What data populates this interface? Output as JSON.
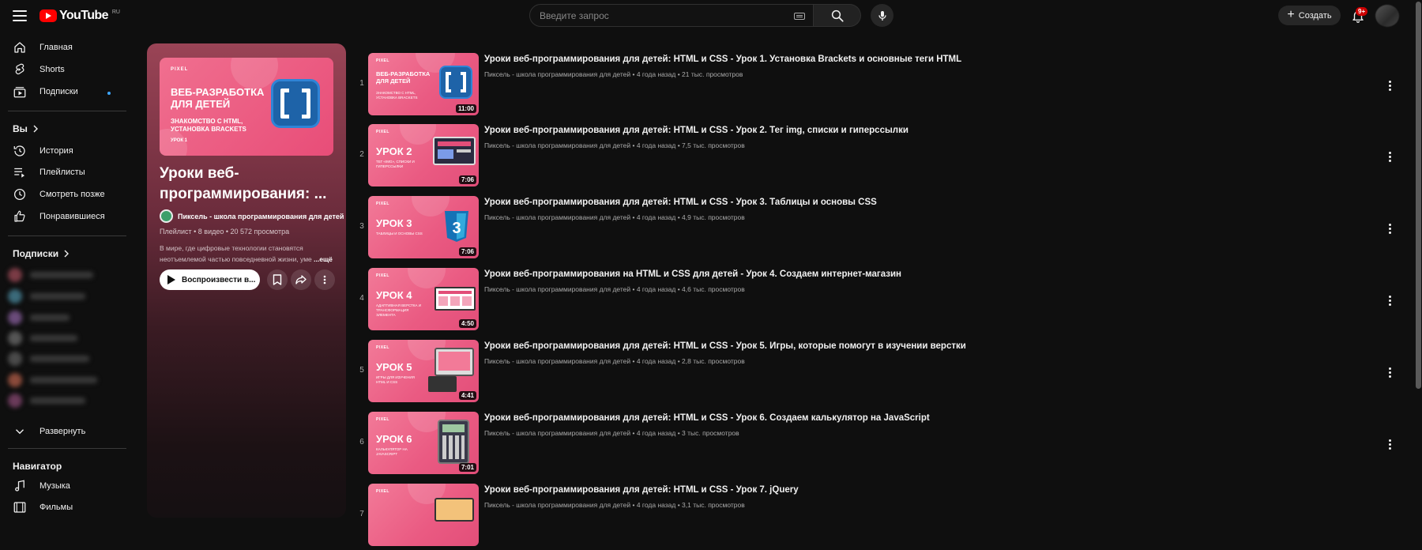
{
  "header": {
    "logo_text": "YouTube",
    "region": "RU",
    "search_placeholder": "Введите запрос",
    "create_label": "Создать",
    "notifications_badge": "9+"
  },
  "sidebar": {
    "main": [
      {
        "label": "Главная",
        "icon": "home-icon"
      },
      {
        "label": "Shorts",
        "icon": "shorts-icon"
      },
      {
        "label": "Подписки",
        "icon": "subscriptions-icon"
      }
    ],
    "you_label": "Вы",
    "you_items": [
      {
        "label": "История",
        "icon": "history-icon"
      },
      {
        "label": "Плейлисты",
        "icon": "playlists-icon"
      },
      {
        "label": "Смотреть позже",
        "icon": "watch-later-icon"
      },
      {
        "label": "Понравившиеся",
        "icon": "like-icon"
      }
    ],
    "subscriptions_label": "Подписки",
    "expand_label": "Развернуть",
    "navigator_label": "Навигатор",
    "navigator_items": [
      {
        "label": "Музыка",
        "icon": "music-icon"
      },
      {
        "label": "Фильмы",
        "icon": "movies-icon"
      }
    ]
  },
  "playlist": {
    "thumb_brand": "PIXEL",
    "thumb_title": "ВЕБ-РАЗРАБОТКА ДЛЯ ДЕТЕЙ",
    "thumb_subtitle": "ЗНАКОМСТВО С HTML, УСТАНОВКА BRACKETS",
    "thumb_lesson": "УРОК 1",
    "title": "Уроки веб-программирования: ...",
    "channel": "Пиксель - школа программирования для детей",
    "meta": "Плейлист • 8 видео • 20 572 просмотра",
    "description": "В мире, где цифровые технологии становятся неотъемлемой частью повседневной жизни, уме",
    "more_label": "...ещё",
    "play_label": "Воспроизвести в..."
  },
  "videos": [
    {
      "index": "1",
      "title": "Уроки веб-программирования для детей: HTML и CSS - Урок 1. Установка Brackets и основные теги HTML",
      "meta": "Пиксель - школа программирования для детей • 4 года назад • 21 тыс. просмотров",
      "duration": "11:00",
      "lesson": "ВЕБ-РАЗРАБОТКА ДЛЯ ДЕТЕЙ",
      "sub": "ЗНАКОМСТВО С HTML, УСТАНОВКА BRACKETS"
    },
    {
      "index": "2",
      "title": "Уроки веб-программирования для детей: HTML и CSS - Урок 2. Тег img, списки и гиперссылки",
      "meta": "Пиксель - школа программирования для детей • 4 года назад • 7,5 тыс. просмотров",
      "duration": "7:06",
      "lesson": "УРОК 2",
      "sub": "ТЕГ «IMG», СПИСКИ И ГИПЕРССЫЛКИ"
    },
    {
      "index": "3",
      "title": "Уроки веб-программирования для детей: HTML и CSS - Урок 3. Таблицы и основы CSS",
      "meta": "Пиксель - школа программирования для детей • 4 года назад • 4,9 тыс. просмотров",
      "duration": "7:06",
      "lesson": "УРОК 3",
      "sub": "ТАБЛИЦЫ И ОСНОВЫ CSS"
    },
    {
      "index": "4",
      "title": "Уроки веб-программирования на HTML и CSS для детей - Урок 4. Создаем интернет-магазин",
      "meta": "Пиксель - школа программирования для детей • 4 года назад • 4,6 тыс. просмотров",
      "duration": "4:50",
      "lesson": "УРОК 4",
      "sub": "АДАПТИВНАЯ ВЕРСТКА И ТРАНСФОРМАЦИЯ ЭЛЕМЕНТА"
    },
    {
      "index": "5",
      "title": "Уроки веб-программирования для детей: HTML и CSS - Урок 5. Игры, которые помогут в изучении верстки",
      "meta": "Пиксель - школа программирования для детей • 4 года назад • 2,8 тыс. просмотров",
      "duration": "4:41",
      "lesson": "УРОК 5",
      "sub": "ИГРЫ ДЛЯ ИЗУЧЕНИЯ HTML И CSS"
    },
    {
      "index": "6",
      "title": "Уроки веб-программирования для детей: HTML и CSS - Урок 6. Создаем калькулятор на JavaScript",
      "meta": "Пиксель - школа программирования для детей • 4 года назад • 3 тыс. просмотров",
      "duration": "7:01",
      "lesson": "УРОК 6",
      "sub": "КАЛЬКУЛЯТОР НА JAVASCRIPT"
    },
    {
      "index": "7",
      "title": "Уроки веб-программирования для детей: HTML и CSS - Урок 7. jQuery",
      "meta": "Пиксель - школа программирования для детей • 4 года назад • 3,1 тыс. просмотров",
      "duration": "",
      "lesson": "",
      "sub": ""
    }
  ],
  "colors": {
    "background": "#0f0f0f",
    "brand_red": "#ff0000",
    "thumb_pink": "#ea5a82",
    "panel_top": "#9a4456"
  }
}
